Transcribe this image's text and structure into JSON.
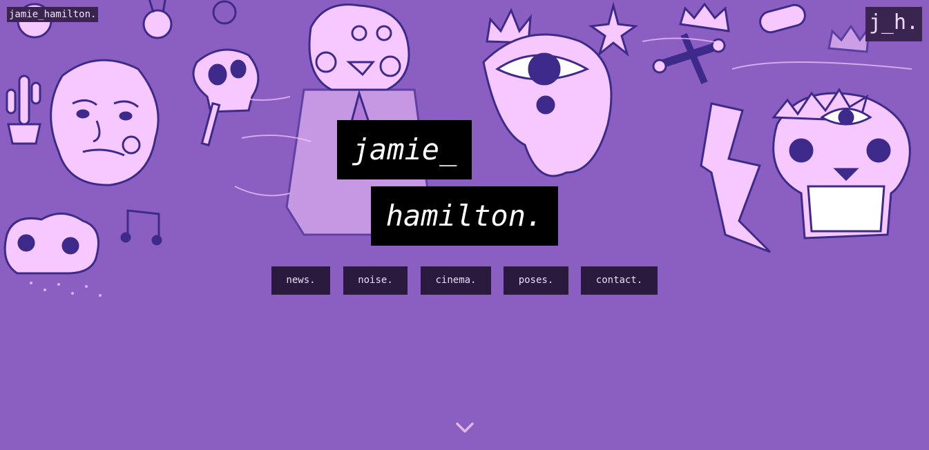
{
  "page": {
    "background_color": "#8a5fc1",
    "doodle_color": "#f7c8ff",
    "ink_color": "#3d2a8a"
  },
  "header": {
    "corner_label": "jamie_hamilton.",
    "logo_text": "j_h."
  },
  "hero": {
    "title_line1": "jamie_",
    "title_line2": "hamilton."
  },
  "nav": {
    "items": [
      {
        "label": "news."
      },
      {
        "label": "noise."
      },
      {
        "label": "cinema."
      },
      {
        "label": "poses."
      },
      {
        "label": "contact."
      }
    ]
  },
  "scroll_indicator": {
    "icon": "chevron-down-icon"
  }
}
